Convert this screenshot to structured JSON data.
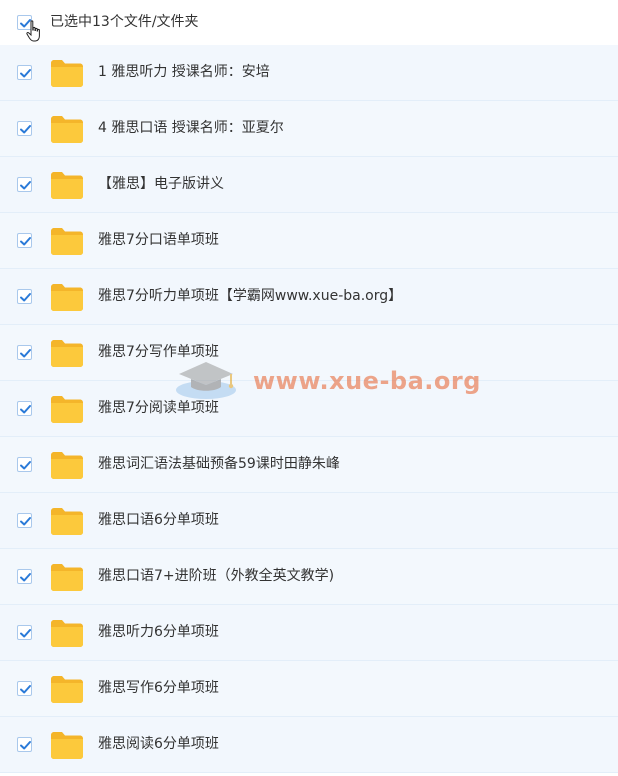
{
  "header": {
    "select_all_checked": true,
    "selection_text": "已选中13个文件/文件夹"
  },
  "items": [
    {
      "name": "1 雅思听力 授课名师：安培",
      "checked": true,
      "icon": "folder-icon"
    },
    {
      "name": "4 雅思口语 授课名师：亚夏尔",
      "checked": true,
      "icon": "folder-icon"
    },
    {
      "name": "【雅思】电子版讲义",
      "checked": true,
      "icon": "folder-icon"
    },
    {
      "name": "雅思7分口语单项班",
      "checked": true,
      "icon": "folder-icon"
    },
    {
      "name": "雅思7分听力单项班【学霸网www.xue-ba.org】",
      "checked": true,
      "icon": "folder-icon"
    },
    {
      "name": "雅思7分写作单项班",
      "checked": true,
      "icon": "folder-icon"
    },
    {
      "name": "雅思7分阅读单项班",
      "checked": true,
      "icon": "folder-icon"
    },
    {
      "name": "雅思词汇语法基础预备59课时田静朱峰",
      "checked": true,
      "icon": "folder-icon"
    },
    {
      "name": "雅思口语6分单项班",
      "checked": true,
      "icon": "folder-icon"
    },
    {
      "name": "雅思口语7+进阶班（外教全英文教学)",
      "checked": true,
      "icon": "folder-icon"
    },
    {
      "name": "雅思听力6分单项班",
      "checked": true,
      "icon": "folder-icon"
    },
    {
      "name": "雅思写作6分单项班",
      "checked": true,
      "icon": "folder-icon"
    },
    {
      "name": "雅思阅读6分单项班",
      "checked": true,
      "icon": "folder-icon"
    }
  ],
  "watermark": {
    "text": "www.xue-ba.org"
  },
  "colors": {
    "checkbox_check": "#2a7ad8",
    "folder": "#fcc93c",
    "row_bg": "#f3f8fd",
    "divider": "#e3eef9"
  }
}
